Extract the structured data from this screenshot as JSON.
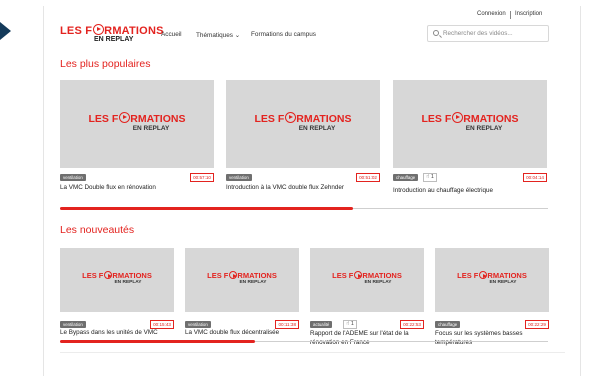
{
  "header": {
    "logo_line1_a": "LES F",
    "logo_line1_b": "RMATIONS",
    "logo_line2": "EN REPLAY",
    "nav": {
      "home": "Accueil",
      "themes": "Thématiques",
      "themes_caret": "⌄",
      "campus": "Formations du campus"
    },
    "auth": {
      "login": "Connexion",
      "signup": "Inscription"
    },
    "search": {
      "placeholder": "Rechercher des vidéos..."
    }
  },
  "sections": [
    {
      "title": "Les plus populaires",
      "progress_fraction": 0.6,
      "cards": [
        {
          "tag": "ventilation",
          "duration": "00:57:10",
          "title": "La VMC Double flux en rénovation",
          "likes": null
        },
        {
          "tag": "ventilation",
          "duration": "00:51:02",
          "title": "Introduction à la VMC double flux Zehnder",
          "likes": null
        },
        {
          "tag": "chauffage",
          "duration": "00:04:14",
          "title": "Introduction au chauffage électrique",
          "likes": "1"
        }
      ]
    },
    {
      "title": "Les nouveautés",
      "progress_fraction": 0.4,
      "cards": [
        {
          "tag": "ventilation",
          "duration": "00:15:43",
          "title": "Le Bypass dans les unités de VMC",
          "likes": null
        },
        {
          "tag": "ventilation",
          "duration": "00:11:38",
          "title": "La VMC double flux décentralisée",
          "likes": null
        },
        {
          "tag": "actualité",
          "duration": "00:22:53",
          "title": "Rapport de l'ADEME sur l'état de la rénovation en France",
          "likes": "1"
        },
        {
          "tag": "chauffage",
          "duration": "00:22:29",
          "title": "Focus sur les systèmes basses températures",
          "likes": null
        }
      ]
    }
  ],
  "thumbnail_logo": {
    "line1_a": "LES F",
    "line1_b": "RMATIONS",
    "line2": "EN REPLAY"
  },
  "like_icon": "thumbs-up-icon",
  "colors": {
    "brand_red": "#e3231f",
    "tag_gray": "#6f6f6f",
    "thumb_bg": "#d7d7d7"
  }
}
